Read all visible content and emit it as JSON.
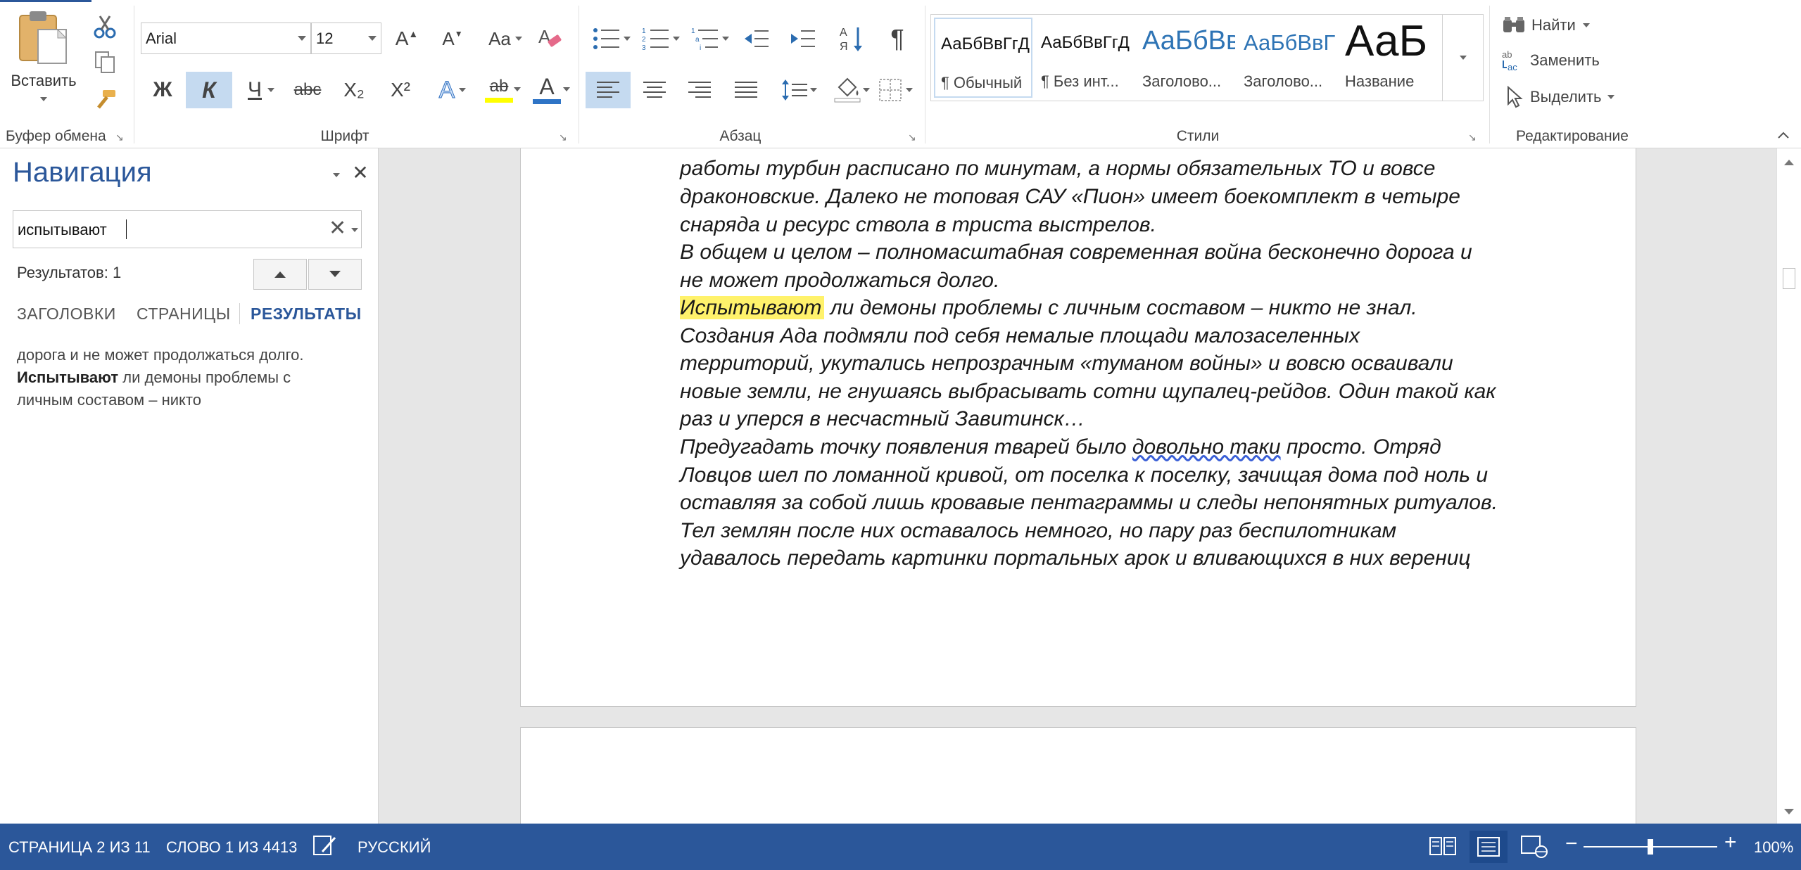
{
  "ribbon": {
    "clipboard": {
      "paste_label": "Вставить",
      "group_label": "Буфер обмена"
    },
    "font": {
      "font_name": "Arial",
      "font_size": "12",
      "bold_label": "Ж",
      "italic_label": "К",
      "underline_label": "Ч",
      "strike_label": "abc",
      "subscript_label": "X₂",
      "superscript_label": "X²",
      "case_label": "Aa",
      "highlight_label": "ab",
      "font_color_label": "A",
      "effects_label": "A",
      "grow_label": "A",
      "shrink_label": "A",
      "group_label": "Шрифт"
    },
    "paragraph": {
      "group_label": "Абзац",
      "pilcrow": "¶"
    },
    "styles": {
      "group_label": "Стили",
      "items": [
        {
          "sample": "АаБбВвГгД",
          "name": "¶ Обычный"
        },
        {
          "sample": "АаБбВвГгД",
          "name": "¶ Без инт..."
        },
        {
          "sample": "АаБбВв",
          "name": "Заголово..."
        },
        {
          "sample": "АаБбВвГ",
          "name": "Заголово..."
        },
        {
          "sample": "АаБ",
          "name": "Название"
        }
      ]
    },
    "editing": {
      "find_label": "Найти",
      "replace_label": "Заменить",
      "select_label": "Выделить",
      "group_label": "Редактирование"
    }
  },
  "navigation": {
    "title": "Навигация",
    "search_value": "испытывают",
    "results_count": "Результатов: 1",
    "tabs": [
      "ЗАГОЛОВКИ",
      "СТРАНИЦЫ",
      "РЕЗУЛЬТАТЫ"
    ],
    "result_snippet": {
      "line1": "дорога и не может продолжаться долго.",
      "match": "Испытывают",
      "line2_rest": " ли демоны проблемы с",
      "line3": "личным составом – никто"
    }
  },
  "document": {
    "lines": [
      "работы турбин расписано по минутам, а нормы обязательных ТО и вовсе",
      "драконовские. Далеко не топовая САУ «Пион» имеет боекомплект в четыре",
      "снаряда и ресурс ствола в триста выстрелов.",
      "В общем и целом – полномасштабная современная война бесконечно дорога и",
      "не может продолжаться долго.",
      "ли демоны проблемы с личным составом – никто не знал.",
      "Создания Ада подмяли под себя немалые площади малозаселенных",
      "территорий, укутались непрозрачным «туманом войны» и вовсю осваивали",
      "новые земли, не гнушаясь выбрасывать сотни щупалец-рейдов. Один такой как",
      "раз и уперся в несчастный Завитинск…",
      "Предугадать точку появления тварей было ",
      "довольно таки",
      " просто. Отряд",
      "Ловцов шел по ломанной кривой, от поселка к поселку, зачищая дома под ноль и",
      "оставляя за собой лишь кровавые пентаграммы и следы непонятных ритуалов.",
      "Тел землян после них оставалось немного, но пару раз беспилотникам",
      "удавалось передать картинки портальных арок и вливающихся в них верениц"
    ],
    "highlight_word": "Испытывают",
    "highlight_color": "#fff26b"
  },
  "statusbar": {
    "page": "СТРАНИЦА 2 ИЗ 11",
    "words": "СЛОВО 1 ИЗ 4413",
    "language": "РУССКИЙ",
    "zoom": "100%",
    "zoom_level": 1.0,
    "background": "#2b579a"
  },
  "colors": {
    "accent": "#2b579a",
    "nav_active_tab": "#2b579a"
  }
}
